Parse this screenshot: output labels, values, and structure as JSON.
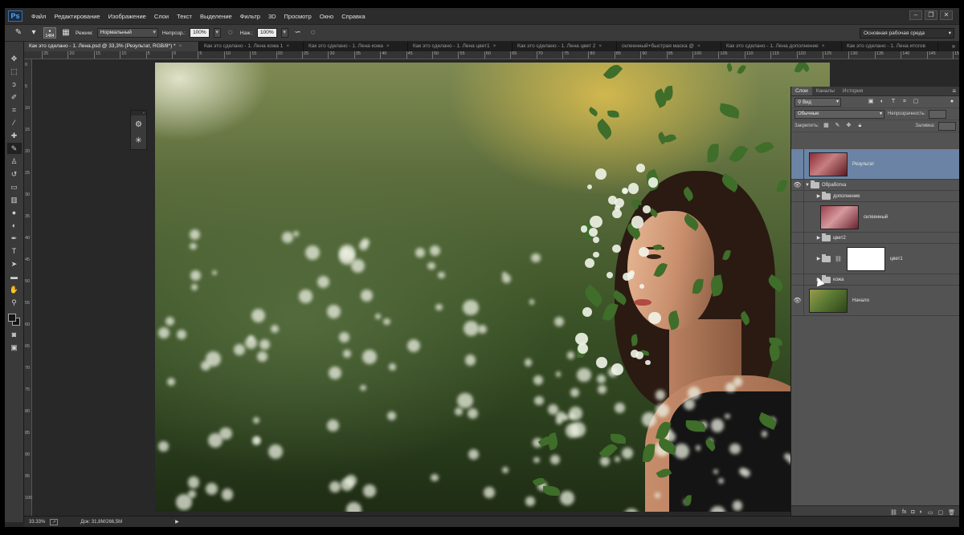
{
  "app": {
    "logo": "Ps"
  },
  "menu": [
    "Файл",
    "Редактирование",
    "Изображение",
    "Слои",
    "Текст",
    "Выделение",
    "Фильтр",
    "3D",
    "Просмотр",
    "Окно",
    "Справка"
  ],
  "options": {
    "brush_size": "1484",
    "mode_label": "Режим:",
    "mode_value": "Нормальный",
    "opacity_label": "Непрозр.:",
    "opacity_value": "100%",
    "flow_label": "Наж.:",
    "flow_value": "100%",
    "workspace": "Основная рабочая среда"
  },
  "tabs": [
    "Как это сделано - 1. Лена.psd @ 33,3% (Результат, RGB/8*) *",
    "Как это сделано - 1. Лена кожа 1",
    "Как это сделано - 1. Лена кожа",
    "Как это сделано - 1. Лена цвет1",
    "Как это сделано - 1. Лена цвет 2",
    "склеенный+быстрая маска @",
    "Как это сделано - 1. Лена дополнение",
    "Как это сделано - 1. Лена итогов"
  ],
  "ruler_top": [
    "25",
    "20",
    "15",
    "10",
    "5",
    "0",
    "5",
    "10",
    "15",
    "20",
    "25",
    "30",
    "35",
    "40",
    "45",
    "50",
    "55",
    "60",
    "65",
    "70",
    "75",
    "80",
    "85",
    "90",
    "95",
    "100",
    "105",
    "110",
    "115",
    "120",
    "125",
    "130",
    "135",
    "140",
    "145",
    "150"
  ],
  "ruler_left": [
    "0",
    "5",
    "10",
    "15",
    "20",
    "25",
    "30",
    "35",
    "40",
    "45",
    "50",
    "55",
    "60",
    "65",
    "70",
    "75",
    "80",
    "85",
    "90",
    "95",
    "100"
  ],
  "layers_panel": {
    "tabs": [
      "Слои",
      "Каналы",
      "История"
    ],
    "filter_value": "Вид",
    "blend_value": "Обычные",
    "opacity_label": "Непрозрачность:",
    "lock_label": "Закрепить:",
    "fill_label": "Заливка:",
    "layers": [
      {
        "name": "Результат",
        "type": "layer",
        "selected": true,
        "visible": false
      },
      {
        "name": "Обработка",
        "type": "group",
        "visible": true
      },
      {
        "name": "дополнение",
        "type": "group",
        "visible": false
      },
      {
        "name": "склеенный",
        "type": "layer",
        "visible": false
      },
      {
        "name": "цвет2",
        "type": "group",
        "visible": false
      },
      {
        "name": "цвет1",
        "type": "group",
        "visible": false
      },
      {
        "name": "кожа",
        "type": "group",
        "visible": false
      },
      {
        "name": "Начало",
        "type": "layer",
        "visible": true
      }
    ]
  },
  "status": {
    "zoom": "33.33%",
    "doc": "Док: 31,8M/266,5M"
  }
}
